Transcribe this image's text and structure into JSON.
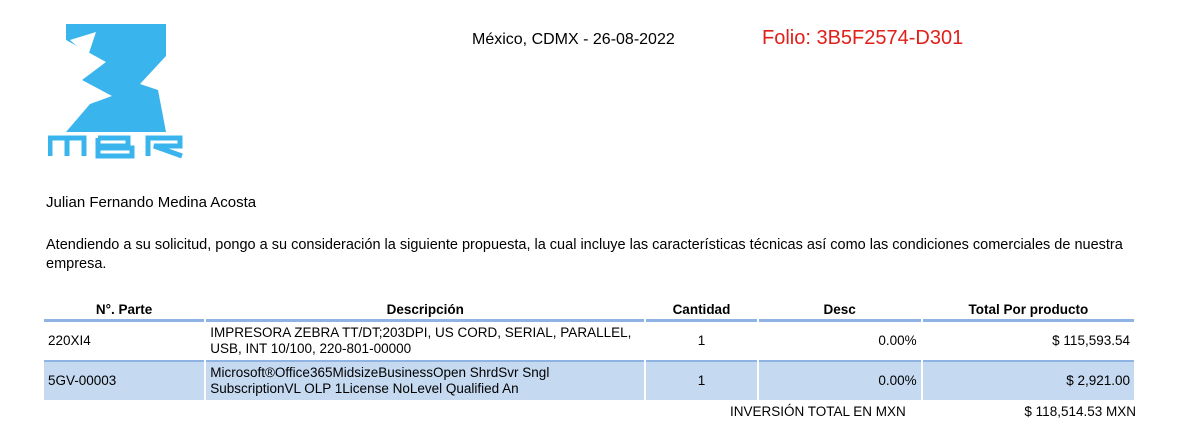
{
  "header": {
    "logo_text": "MBR",
    "place_date": "México, CDMX - 26-08-2022",
    "folio": "Folio: 3B5F2574-D301"
  },
  "recipient": "Julian Fernando Medina Acosta",
  "intro": "Atendiendo a su solicitud, pongo a su consideración la siguiente propuesta, la cual incluye las características técnicas así como las condiciones comerciales de nuestra empresa.",
  "table": {
    "headers": [
      "N°. Parte",
      "Descripción",
      "Cantidad",
      "Desc",
      "Total Por producto"
    ],
    "rows": [
      {
        "part": "220XI4",
        "description": "IMPRESORA ZEBRA TT/DT;203DPI, US CORD, SERIAL, PARALLEL, USB, INT 10/100, 220-801-00000",
        "quantity": "1",
        "discount": "0.00%",
        "total": "$ 115,593.54"
      },
      {
        "part": "5GV-00003",
        "description": "Microsoft®Office365MidsizeBusinessOpen ShrdSvr Sngl SubscriptionVL OLP 1License NoLevel Qualified An",
        "quantity": "1",
        "discount": "0.00%",
        "total": "$ 2,921.00"
      }
    ]
  },
  "summary": {
    "label": "INVERSIÓN TOTAL EN MXN",
    "value": "$ 118,514.53 MXN"
  },
  "colors": {
    "logo_blue": "#3ab4ec",
    "folio_red": "#e0201a",
    "row_highlight": "#c5d9f1",
    "rule_blue": "#8fb4e3"
  }
}
